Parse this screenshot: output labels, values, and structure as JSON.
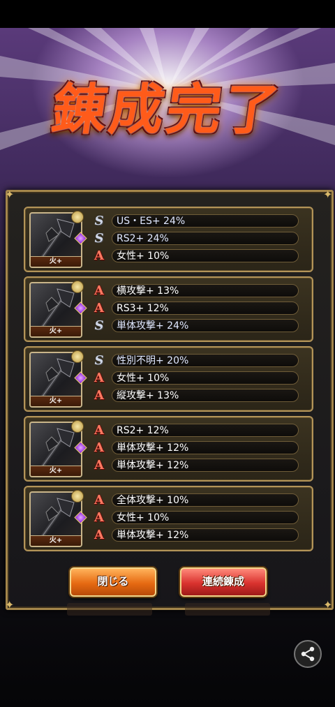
{
  "title": "錬成完了",
  "element_label": "火+",
  "cards": [
    {
      "rows": [
        {
          "rank": "S",
          "text": "US・ES+ 24%"
        },
        {
          "rank": "S",
          "text": "RS2+ 24%"
        },
        {
          "rank": "A",
          "text": "女性+ 10%"
        }
      ]
    },
    {
      "rows": [
        {
          "rank": "A",
          "text": "横攻撃+ 13%"
        },
        {
          "rank": "A",
          "text": "RS3+ 12%"
        },
        {
          "rank": "S",
          "text": "単体攻撃+ 24%"
        }
      ]
    },
    {
      "rows": [
        {
          "rank": "S",
          "text": "性別不明+ 20%"
        },
        {
          "rank": "A",
          "text": "女性+ 10%"
        },
        {
          "rank": "A",
          "text": "縦攻撃+ 13%"
        }
      ]
    },
    {
      "rows": [
        {
          "rank": "A",
          "text": "RS2+ 12%"
        },
        {
          "rank": "A",
          "text": "単体攻撃+ 12%"
        },
        {
          "rank": "A",
          "text": "単体攻撃+ 12%"
        }
      ]
    },
    {
      "rows": [
        {
          "rank": "A",
          "text": "全体攻撃+ 10%"
        },
        {
          "rank": "A",
          "text": "女性+ 10%"
        },
        {
          "rank": "A",
          "text": "単体攻撃+ 12%"
        }
      ]
    }
  ],
  "buttons": {
    "close": "閉じる",
    "continue": "連続錬成"
  },
  "colors": {
    "rank_a": "#ff7a62",
    "rank_s": "#cfd6e6",
    "frame_gold": "#b39458"
  },
  "icons": {
    "share": "share-icon",
    "weapon": "axe-weapon-icon",
    "element": "fire-element-icon"
  }
}
